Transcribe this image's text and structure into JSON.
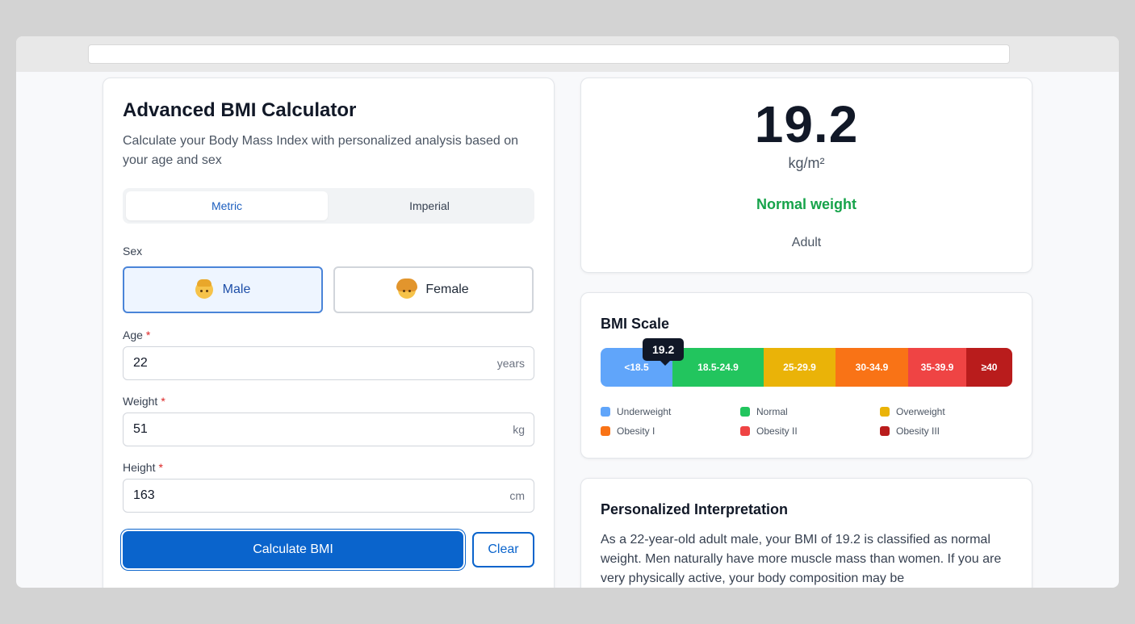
{
  "calculator": {
    "title": "Advanced BMI Calculator",
    "subtitle": "Calculate your Body Mass Index with personalized analysis based on your age and sex",
    "unit_tabs": [
      {
        "label": "Metric",
        "active": true
      },
      {
        "label": "Imperial",
        "active": false
      }
    ],
    "sex": {
      "label": "Sex",
      "options": [
        {
          "label": "Male",
          "selected": true,
          "icon": "man-emoji-icon"
        },
        {
          "label": "Female",
          "selected": false,
          "icon": "woman-emoji-icon"
        }
      ]
    },
    "age": {
      "label": "Age",
      "required_mark": "*",
      "value": "22",
      "suffix": "years"
    },
    "weight": {
      "label": "Weight",
      "required_mark": "*",
      "value": "51",
      "suffix": "kg"
    },
    "height": {
      "label": "Height",
      "required_mark": "*",
      "value": "163",
      "suffix": "cm"
    },
    "calculate_label": "Calculate BMI",
    "clear_label": "Clear"
  },
  "result": {
    "value": "19.2",
    "unit": "kg/m²",
    "category": "Normal weight",
    "age_group": "Adult",
    "category_color": "#16a34a"
  },
  "scale": {
    "title": "BMI Scale",
    "marker_value": "19.2",
    "segments": [
      {
        "label": "<18.5",
        "color": "#60a5fa"
      },
      {
        "label": "18.5-24.9",
        "color": "#22c55e"
      },
      {
        "label": "25-29.9",
        "color": "#eab308"
      },
      {
        "label": "30-34.9",
        "color": "#f97316"
      },
      {
        "label": "35-39.9",
        "color": "#ef4444"
      },
      {
        "label": "≥40",
        "color": "#b91c1c"
      }
    ],
    "legend": [
      {
        "label": "Underweight",
        "color": "#60a5fa"
      },
      {
        "label": "Normal",
        "color": "#22c55e"
      },
      {
        "label": "Overweight",
        "color": "#eab308"
      },
      {
        "label": "Obesity I",
        "color": "#f97316"
      },
      {
        "label": "Obesity II",
        "color": "#ef4444"
      },
      {
        "label": "Obesity III",
        "color": "#b91c1c"
      }
    ]
  },
  "interpretation": {
    "title": "Personalized Interpretation",
    "text": "As a 22-year-old adult male, your BMI of 19.2 is classified as normal weight. Men naturally have more muscle mass than women. If you are very physically active, your body composition may be"
  }
}
